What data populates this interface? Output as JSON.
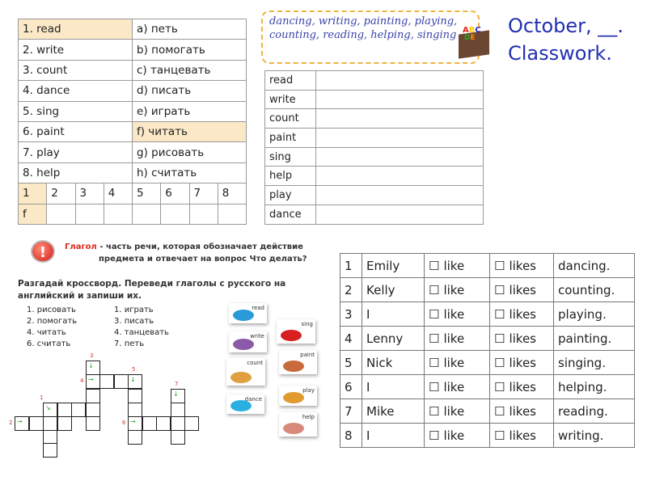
{
  "match_table": {
    "rows": [
      [
        "1. read",
        "a) петь"
      ],
      [
        "2. write",
        "b) помогать"
      ],
      [
        "3. count",
        "c) танцевать"
      ],
      [
        "4. dance",
        "d) писать"
      ],
      [
        "5. sing",
        "e) играть"
      ],
      [
        "6. paint",
        "f) читать"
      ],
      [
        "7. play",
        "g) рисовать"
      ],
      [
        "8. help",
        "h) считать"
      ]
    ],
    "answer_numbers": [
      "1",
      "2",
      "3",
      "4",
      "5",
      "6",
      "7",
      "8"
    ],
    "answer_letters": [
      "f",
      "",
      "",
      "",
      "",
      "",
      "",
      ""
    ]
  },
  "word_box": {
    "text": "dancing, writing, painting, playing, counting, reading, helping, singing",
    "icon": "abc-box-icon"
  },
  "title": {
    "line1": "October, __.",
    "line2": "Classwork."
  },
  "translate_table": [
    "read",
    "write",
    "count",
    "paint",
    "sing",
    "help",
    "play",
    "dance"
  ],
  "rule": {
    "term": "Глагол",
    "text": " - часть речи, которая обозначает действие",
    "text2": "предмета и отвечает на вопрос Что делать?",
    "icon": "exclamation-icon",
    "accent": "#e0261b"
  },
  "task": "Разгадай кроссворд. Переведи глаголы с русского на английский и запиши их.",
  "clues_left": [
    "1. рисовать",
    "2. помогать",
    "4. читать",
    "6. считать"
  ],
  "clues_right": [
    "1. играть",
    "3. писать",
    "4. танцевать",
    "7. петь"
  ],
  "crossword_numbers": [
    "1",
    "2",
    "3",
    "4",
    "5",
    "6",
    "7"
  ],
  "pictures": [
    "read",
    "sing",
    "write",
    "paint",
    "count",
    "play",
    "dance",
    "help"
  ],
  "likes_table": {
    "rows": [
      [
        "1",
        "Emily",
        "dancing."
      ],
      [
        "2",
        "Kelly",
        "counting."
      ],
      [
        "3",
        "I",
        "playing."
      ],
      [
        "4",
        "Lenny",
        "painting."
      ],
      [
        "5",
        "Nick",
        "singing."
      ],
      [
        "6",
        "I",
        "helping."
      ],
      [
        "7",
        "Mike",
        "reading."
      ],
      [
        "8",
        "I",
        "writing."
      ]
    ],
    "like": "like",
    "likes": "likes",
    "checkbox": "☐"
  }
}
